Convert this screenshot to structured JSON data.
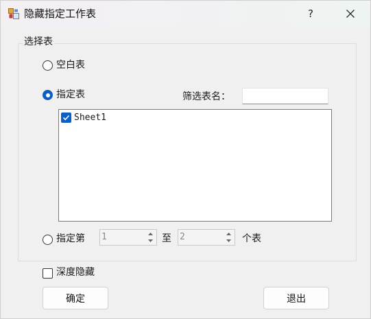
{
  "window": {
    "title": "隐藏指定工作表",
    "help_label": "?"
  },
  "group": {
    "legend": "选择表"
  },
  "options": {
    "blank_sheet": {
      "label": "空白表",
      "checked": false
    },
    "specified_sheet": {
      "label": "指定表",
      "checked": true
    },
    "filter_label": "筛选表名：",
    "filter_value": ""
  },
  "sheet_list": {
    "items": [
      {
        "name": "Sheet1",
        "checked": true
      }
    ]
  },
  "range": {
    "label_prefix": "指定第",
    "from_value": "1",
    "to_label": "至",
    "to_value": "2",
    "suffix": "个表",
    "checked": false
  },
  "deep_hide": {
    "label": "深度隐藏",
    "checked": false
  },
  "buttons": {
    "ok": "确定",
    "exit": "退出"
  },
  "colors": {
    "accent": "#0a5fc4",
    "window_bg": "#f0f0f0"
  }
}
